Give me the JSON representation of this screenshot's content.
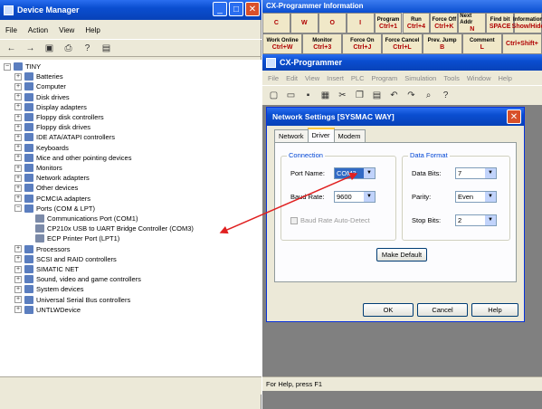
{
  "device_manager": {
    "title": "Device Manager",
    "menu": [
      "File",
      "Action",
      "View",
      "Help"
    ],
    "tree": [
      {
        "label": "TINY",
        "level": 0,
        "expander": "minus"
      },
      {
        "label": "Batteries",
        "level": 1,
        "expander": "plus"
      },
      {
        "label": "Computer",
        "level": 1,
        "expander": "plus"
      },
      {
        "label": "Disk drives",
        "level": 1,
        "expander": "plus"
      },
      {
        "label": "Display adapters",
        "level": 1,
        "expander": "plus"
      },
      {
        "label": "Floppy disk controllers",
        "level": 1,
        "expander": "plus"
      },
      {
        "label": "Floppy disk drives",
        "level": 1,
        "expander": "plus"
      },
      {
        "label": "IDE ATA/ATAPI controllers",
        "level": 1,
        "expander": "plus"
      },
      {
        "label": "Keyboards",
        "level": 1,
        "expander": "plus"
      },
      {
        "label": "Mice and other pointing devices",
        "level": 1,
        "expander": "plus"
      },
      {
        "label": "Monitors",
        "level": 1,
        "expander": "plus"
      },
      {
        "label": "Network adapters",
        "level": 1,
        "expander": "plus"
      },
      {
        "label": "Other devices",
        "level": 1,
        "expander": "plus"
      },
      {
        "label": "PCMCIA adapters",
        "level": 1,
        "expander": "plus"
      },
      {
        "label": "Ports (COM & LPT)",
        "level": 1,
        "expander": "minus"
      },
      {
        "label": "Communications Port (COM1)",
        "level": 2,
        "expander": "none"
      },
      {
        "label": "CP210x USB to UART Bridge Controller (COM3)",
        "level": 2,
        "expander": "none"
      },
      {
        "label": "ECP Printer Port (LPT1)",
        "level": 2,
        "expander": "none"
      },
      {
        "label": "Processors",
        "level": 1,
        "expander": "plus"
      },
      {
        "label": "SCSI and RAID controllers",
        "level": 1,
        "expander": "plus"
      },
      {
        "label": "SIMATIC NET",
        "level": 1,
        "expander": "plus"
      },
      {
        "label": "Sound, video and game controllers",
        "level": 1,
        "expander": "plus"
      },
      {
        "label": "System devices",
        "level": 1,
        "expander": "plus"
      },
      {
        "label": "Universal Serial Bus controllers",
        "level": 1,
        "expander": "plus"
      },
      {
        "label": "UNTLWDevice",
        "level": 1,
        "expander": "plus"
      }
    ]
  },
  "info_window": {
    "title": "CX-Programmer Information",
    "keys": [
      {
        "top": "",
        "bottom": "C"
      },
      {
        "top": "",
        "bottom": "W"
      },
      {
        "top": "",
        "bottom": "O"
      },
      {
        "top": "",
        "bottom": "I"
      },
      {
        "top": "Program",
        "bottom": "Ctrl+1"
      },
      {
        "top": "Run",
        "bottom": "Ctrl+4"
      },
      {
        "top": "Force Off",
        "bottom": "Ctrl+K"
      },
      {
        "top": "Next Addr",
        "bottom": "N"
      },
      {
        "top": "Find bit",
        "bottom": "SPACE"
      },
      {
        "top": "Information",
        "bottom": "Show/Hide"
      }
    ],
    "keys_row2": [
      {
        "top": "Work Online",
        "bottom": "Ctrl+W"
      },
      {
        "top": "Monitor",
        "bottom": "Ctrl+3"
      },
      {
        "top": "Force On",
        "bottom": "Ctrl+J"
      },
      {
        "top": "Force Cancel",
        "bottom": "Ctrl+L"
      },
      {
        "top": "Prev. Jump",
        "bottom": "B"
      },
      {
        "top": "Comment",
        "bottom": "L"
      },
      {
        "top": "",
        "bottom": "Ctrl+Shift+"
      }
    ]
  },
  "cx_programmer": {
    "title": "CX-Programmer",
    "menu": [
      "File",
      "Edit",
      "View",
      "Insert",
      "PLC",
      "Program",
      "Simulation",
      "Tools",
      "Window",
      "Help"
    ],
    "status": "For Help, press F1"
  },
  "dialog": {
    "title": "Network Settings [SYSMAC WAY]",
    "tabs": [
      "Network",
      "Driver",
      "Modem"
    ],
    "active_tab": "Driver",
    "connection": {
      "label": "Connection",
      "port_name_label": "Port Name:",
      "port_name_value": "COM3",
      "baud_rate_label": "Baud Rate:",
      "baud_rate_value": "9600",
      "auto_detect_label": "Baud Rate Auto-Detect"
    },
    "data_format": {
      "label": "Data Format",
      "data_bits_label": "Data Bits:",
      "data_bits_value": "7",
      "parity_label": "Parity:",
      "parity_value": "Even",
      "stop_bits_label": "Stop Bits:",
      "stop_bits_value": "2"
    },
    "make_default": "Make Default",
    "ok": "OK",
    "cancel": "Cancel",
    "help": "Help"
  },
  "colors": {
    "annotation_arrow": "#e02020",
    "xp_blue": "#0a4ed0"
  }
}
